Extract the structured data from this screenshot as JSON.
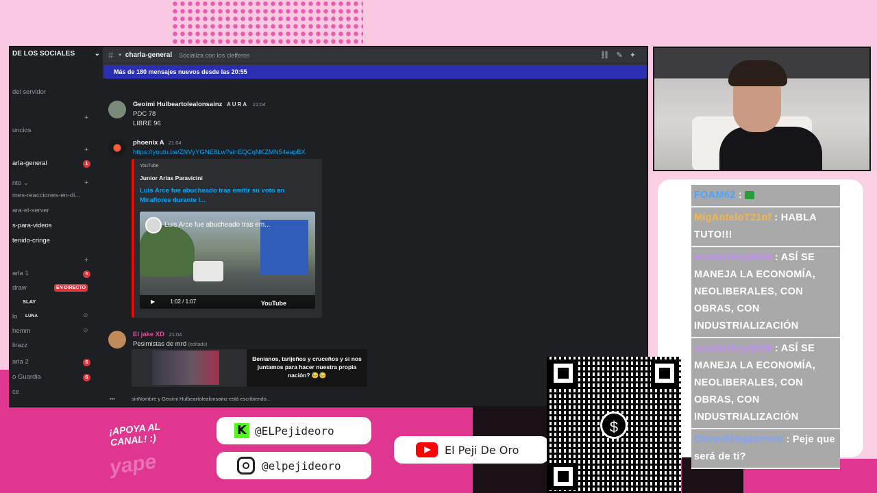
{
  "discord": {
    "server_name": "DE LOS SOCIALES",
    "channel_name": "charla-general",
    "channel_topic": "Socializa con los clefferos",
    "new_messages_banner": "Más de 180 mensajes nuevos desde las 20:55",
    "sidebar": {
      "items": [
        {
          "label": "del servidor"
        },
        {
          "label": "uncios"
        },
        {
          "label": "arla-general",
          "badge": "1"
        },
        {
          "label": "nto ⌄"
        },
        {
          "label": "mes-reacciones-en-di..."
        },
        {
          "label": "ara-el-server"
        },
        {
          "label": "s-para-videos"
        },
        {
          "label": "tenido-cringe"
        },
        {
          "label": "arla 1",
          "badge": "6"
        },
        {
          "label": "draw",
          "live": "EN DIRECTO"
        },
        {
          "label": "SLAY"
        },
        {
          "label": "lo",
          "tag": "LUNA"
        },
        {
          "label": "hemm"
        },
        {
          "label": "lirazz"
        },
        {
          "label": "arla 2",
          "badge": "6"
        },
        {
          "label": "o Guardia",
          "badge": "6"
        },
        {
          "label": "ce"
        }
      ]
    },
    "messages": [
      {
        "author": "Geoimi Hulbeartolealonsainz",
        "tag": "AURA",
        "time": "21:04",
        "lines": [
          "PDC 78",
          "LIBRE 96"
        ]
      },
      {
        "author": "phoenix A",
        "time": "21:04",
        "link": "https://youtu.be/ZNVyYGNE8Lw?si=EQCqNKZMN54eapBX"
      },
      {
        "author": "El jake XD",
        "time": "21:04",
        "text": "Pesimistas de mrd",
        "edited": "(editado)"
      }
    ],
    "embed": {
      "provider": "YouTube",
      "author": "Junior Arias Paravicini",
      "title": "Luis Arce fue abucheado tras emitir su voto en Miraflores durante l...",
      "video_title": "Luis Arce fue abucheado tras em...",
      "video_time": "1:02 / 1:07",
      "video_brand": "YouTube"
    },
    "image_caption": "Benianos, tarijeños y cruceños y si nos juntamos para hacer nuestra propia nación? 😓😓",
    "typing": "sinNombre y Geoimi Hulbeartolealonsainz está escribiendo..."
  },
  "chat": [
    {
      "user": "FOAM62",
      "color": "#4aa3ff",
      "text": ":"
    },
    {
      "user": "MigAnteloT21nf",
      "color": "#f3b64a",
      "text": ": HABLA TUTO!!!"
    },
    {
      "user": "wonderhoy6699",
      "color": "#c28ef5",
      "text": ": ASÍ SE MANEJA LA ECONOMÍA, NEOLIBERALES, CON OBRAS, CON INDUSTRIALIZACIÓN"
    },
    {
      "user": "wonderhoy6699",
      "color": "#c28ef5",
      "text": ": ASÍ SE MANEJA LA ECONOMÍA, NEOLIBERALES, CON OBRAS, CON INDUSTRIALIZACIÓN"
    },
    {
      "user": "Oliver616guerrero",
      "color": "#7fa3ff",
      "text": ": Peje que será de ti?"
    }
  ],
  "promo": {
    "apoya": "¡APOYA AL CANAL! :)",
    "yape": "yape",
    "kick_handle": "@ELPejideoro",
    "instagram_handle": "@elpejideoro",
    "youtube_handle": "El Peji De Oro",
    "qr_symbol": "$"
  }
}
